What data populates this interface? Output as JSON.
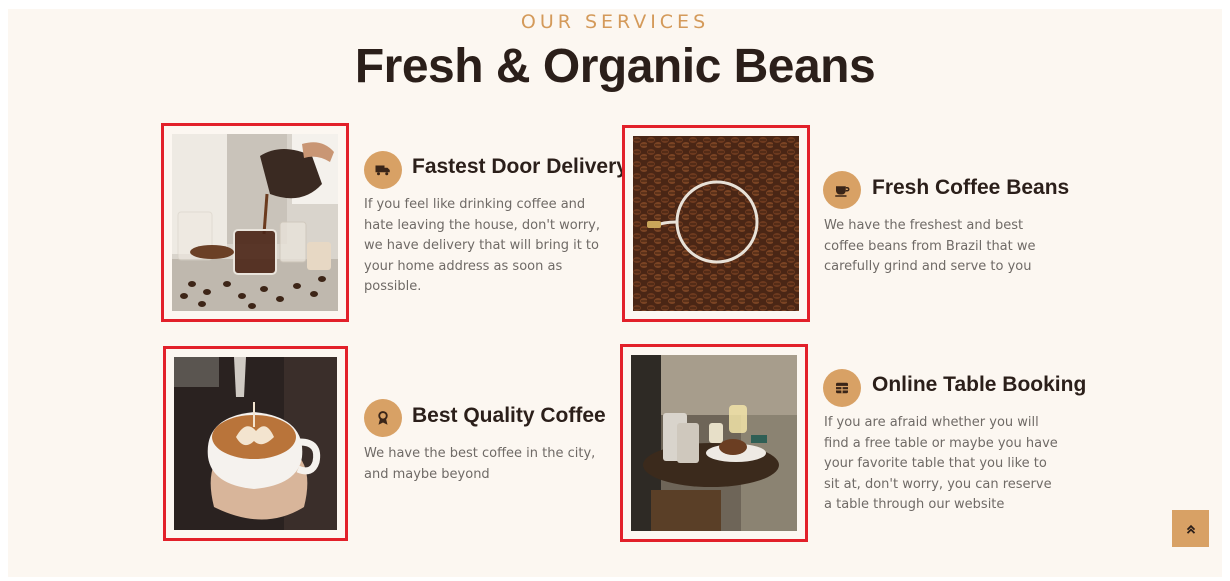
{
  "section": {
    "eyebrow": "OUR SERVICES",
    "title": "Fresh & Organic Beans"
  },
  "services": [
    {
      "title": "Fastest Door Delivery",
      "icon": "truck-icon",
      "image": "pour-over-coffee-with-beans",
      "description": "If you feel like drinking coffee and hate leaving the house, don't worry, we have delivery that will bring it to your home address as soon as possible."
    },
    {
      "title": "Fresh Coffee Beans",
      "icon": "coffee-cup-icon",
      "image": "coffee-beans-in-glass-cup",
      "description": "We have the freshest and best coffee beans from Brazil that we carefully grind and serve to you"
    },
    {
      "title": "Best Quality Coffee",
      "icon": "award-icon",
      "image": "latte-art-pour",
      "description": "We have the best coffee in the city, and maybe beyond"
    },
    {
      "title": "Online Table Booking",
      "icon": "table-icon",
      "image": "cafe-table-with-drinks",
      "description": "If you are afraid whether you will find a free table or maybe you have your favorite table that you like to sit at, don't worry, you can reserve a table through our website"
    }
  ],
  "back_to_top": {
    "icon": "double-chevron-up-icon"
  },
  "colors": {
    "accent": "#d8a165",
    "eyebrow": "#d49a5a",
    "heading": "#2b1f1a",
    "body_text": "#6f6a66",
    "background": "#fcf7f1",
    "highlight_frame": "#e2202a"
  }
}
